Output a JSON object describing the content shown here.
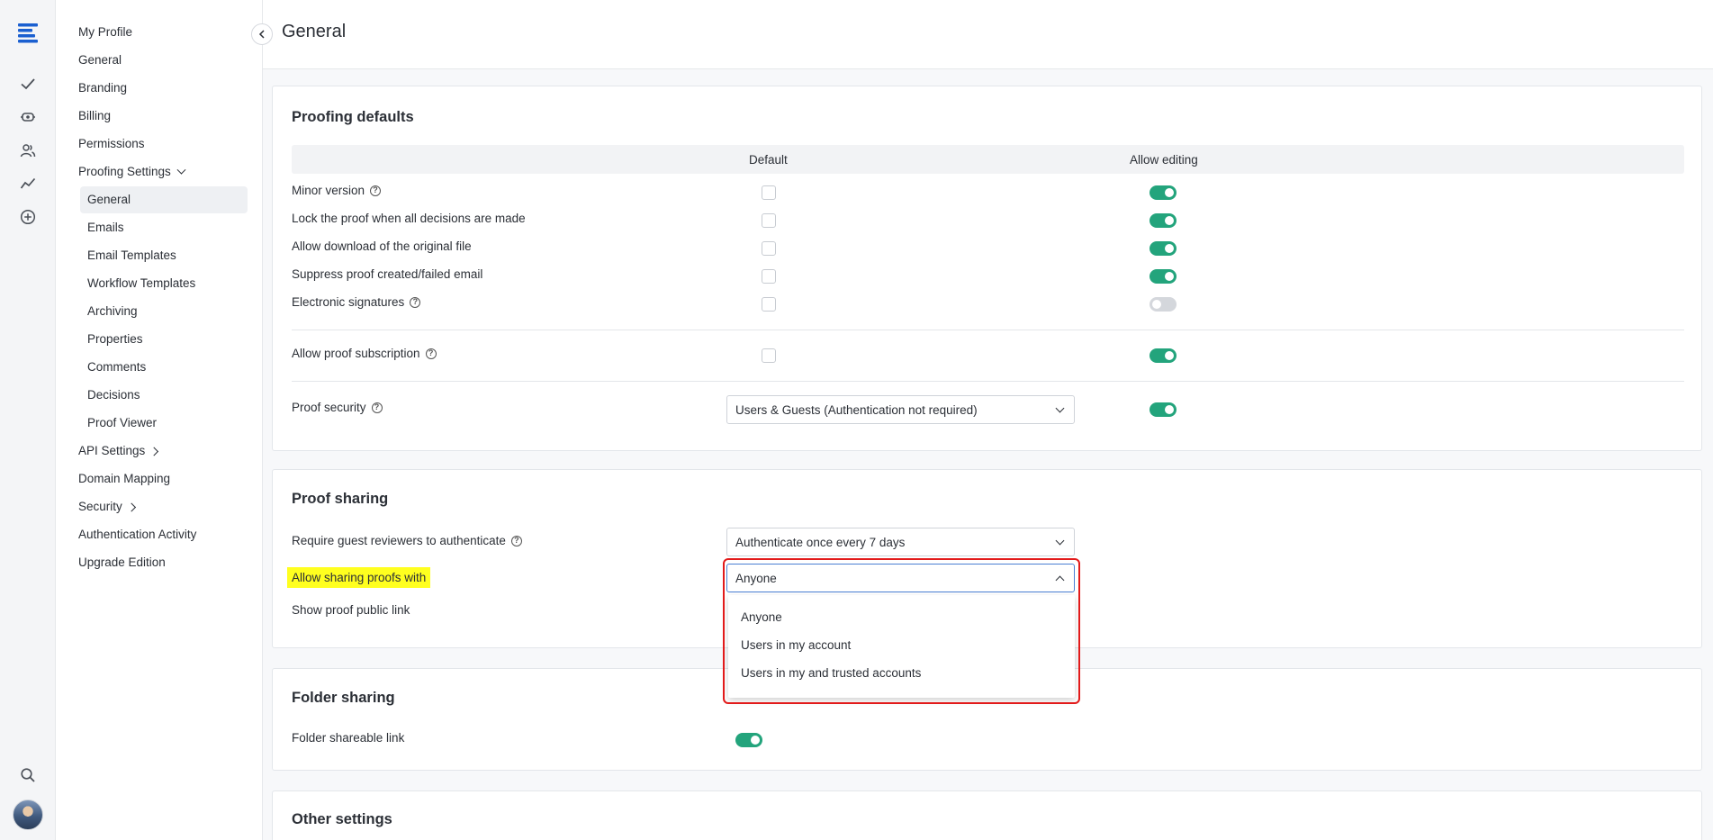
{
  "nav": {
    "items": [
      {
        "label": "My Profile"
      },
      {
        "label": "General"
      },
      {
        "label": "Branding"
      },
      {
        "label": "Billing"
      },
      {
        "label": "Permissions"
      },
      {
        "label": "Proofing Settings"
      },
      {
        "label": "General"
      },
      {
        "label": "Emails"
      },
      {
        "label": "Email Templates"
      },
      {
        "label": "Workflow Templates"
      },
      {
        "label": "Archiving"
      },
      {
        "label": "Properties"
      },
      {
        "label": "Comments"
      },
      {
        "label": "Decisions"
      },
      {
        "label": "Proof Viewer"
      },
      {
        "label": "API Settings"
      },
      {
        "label": "Domain Mapping"
      },
      {
        "label": "Security"
      },
      {
        "label": "Authentication Activity"
      },
      {
        "label": "Upgrade Edition"
      }
    ]
  },
  "page": {
    "title": "General"
  },
  "proofing_defaults": {
    "title": "Proofing defaults",
    "col_default": "Default",
    "col_allow_editing": "Allow editing",
    "rows": [
      {
        "label": "Minor version",
        "default": false,
        "allow_editing": true
      },
      {
        "label": "Lock the proof when all decisions are made",
        "default": false,
        "allow_editing": true
      },
      {
        "label": "Allow download of the original file",
        "default": false,
        "allow_editing": true
      },
      {
        "label": "Suppress proof created/failed email",
        "default": false,
        "allow_editing": true
      },
      {
        "label": "Electronic signatures",
        "default": false,
        "allow_editing": false
      },
      {
        "label": "Allow proof subscription",
        "default": false,
        "allow_editing": true
      },
      {
        "label": "Proof security",
        "value": "Users & Guests (Authentication not required)",
        "allow_editing": true
      }
    ]
  },
  "proof_sharing": {
    "title": "Proof sharing",
    "require_auth_label": "Require guest reviewers to authenticate",
    "require_auth_value": "Authenticate once every 7 days",
    "allow_sharing_label": "Allow sharing proofs with",
    "allow_sharing_value": "Anyone",
    "public_link_label": "Show proof public link",
    "options": [
      "Anyone",
      "Users in my account",
      "Users in my and trusted accounts"
    ]
  },
  "folder_sharing": {
    "title": "Folder sharing",
    "shareable_link_label": "Folder shareable link",
    "shareable_link_on": true
  },
  "other_settings": {
    "title": "Other settings"
  },
  "colors": {
    "toggle_on": "#23a47c",
    "highlight": "#ffff1f",
    "callout": "#e21a1a",
    "brand": "#1a5fd0"
  }
}
